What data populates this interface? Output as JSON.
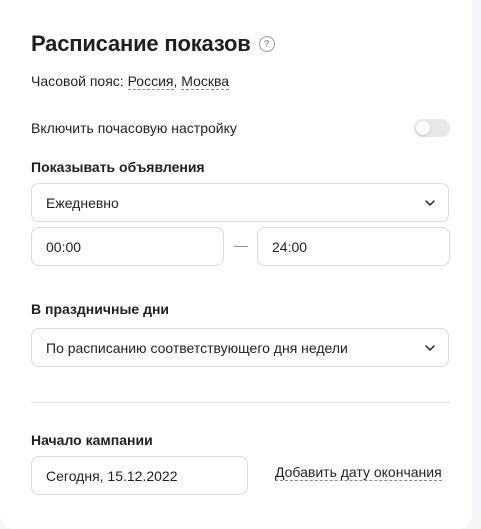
{
  "schedule": {
    "title": "Расписание показов",
    "timezone_label": "Часовой пояс:",
    "timezone_country": "Россия",
    "timezone_comma": ",",
    "timezone_city": "Москва",
    "hourly_toggle_label": "Включить почасовую настройку",
    "hourly_toggle_on": false,
    "show_ads_label": "Показывать объявления",
    "show_ads_value": "Ежедневно",
    "time_from": "00:00",
    "time_separator": "—",
    "time_to": "24:00",
    "holidays_label": "В праздничные дни",
    "holidays_value": "По расписанию соответствующего дня недели",
    "campaign_start_label": "Начало кампании",
    "campaign_start_value": "Сегодня, 15.12.2022",
    "add_end_date": "Добавить дату окончания"
  },
  "icons": {
    "help": "help-icon",
    "chevron": "chevron-down-icon"
  }
}
